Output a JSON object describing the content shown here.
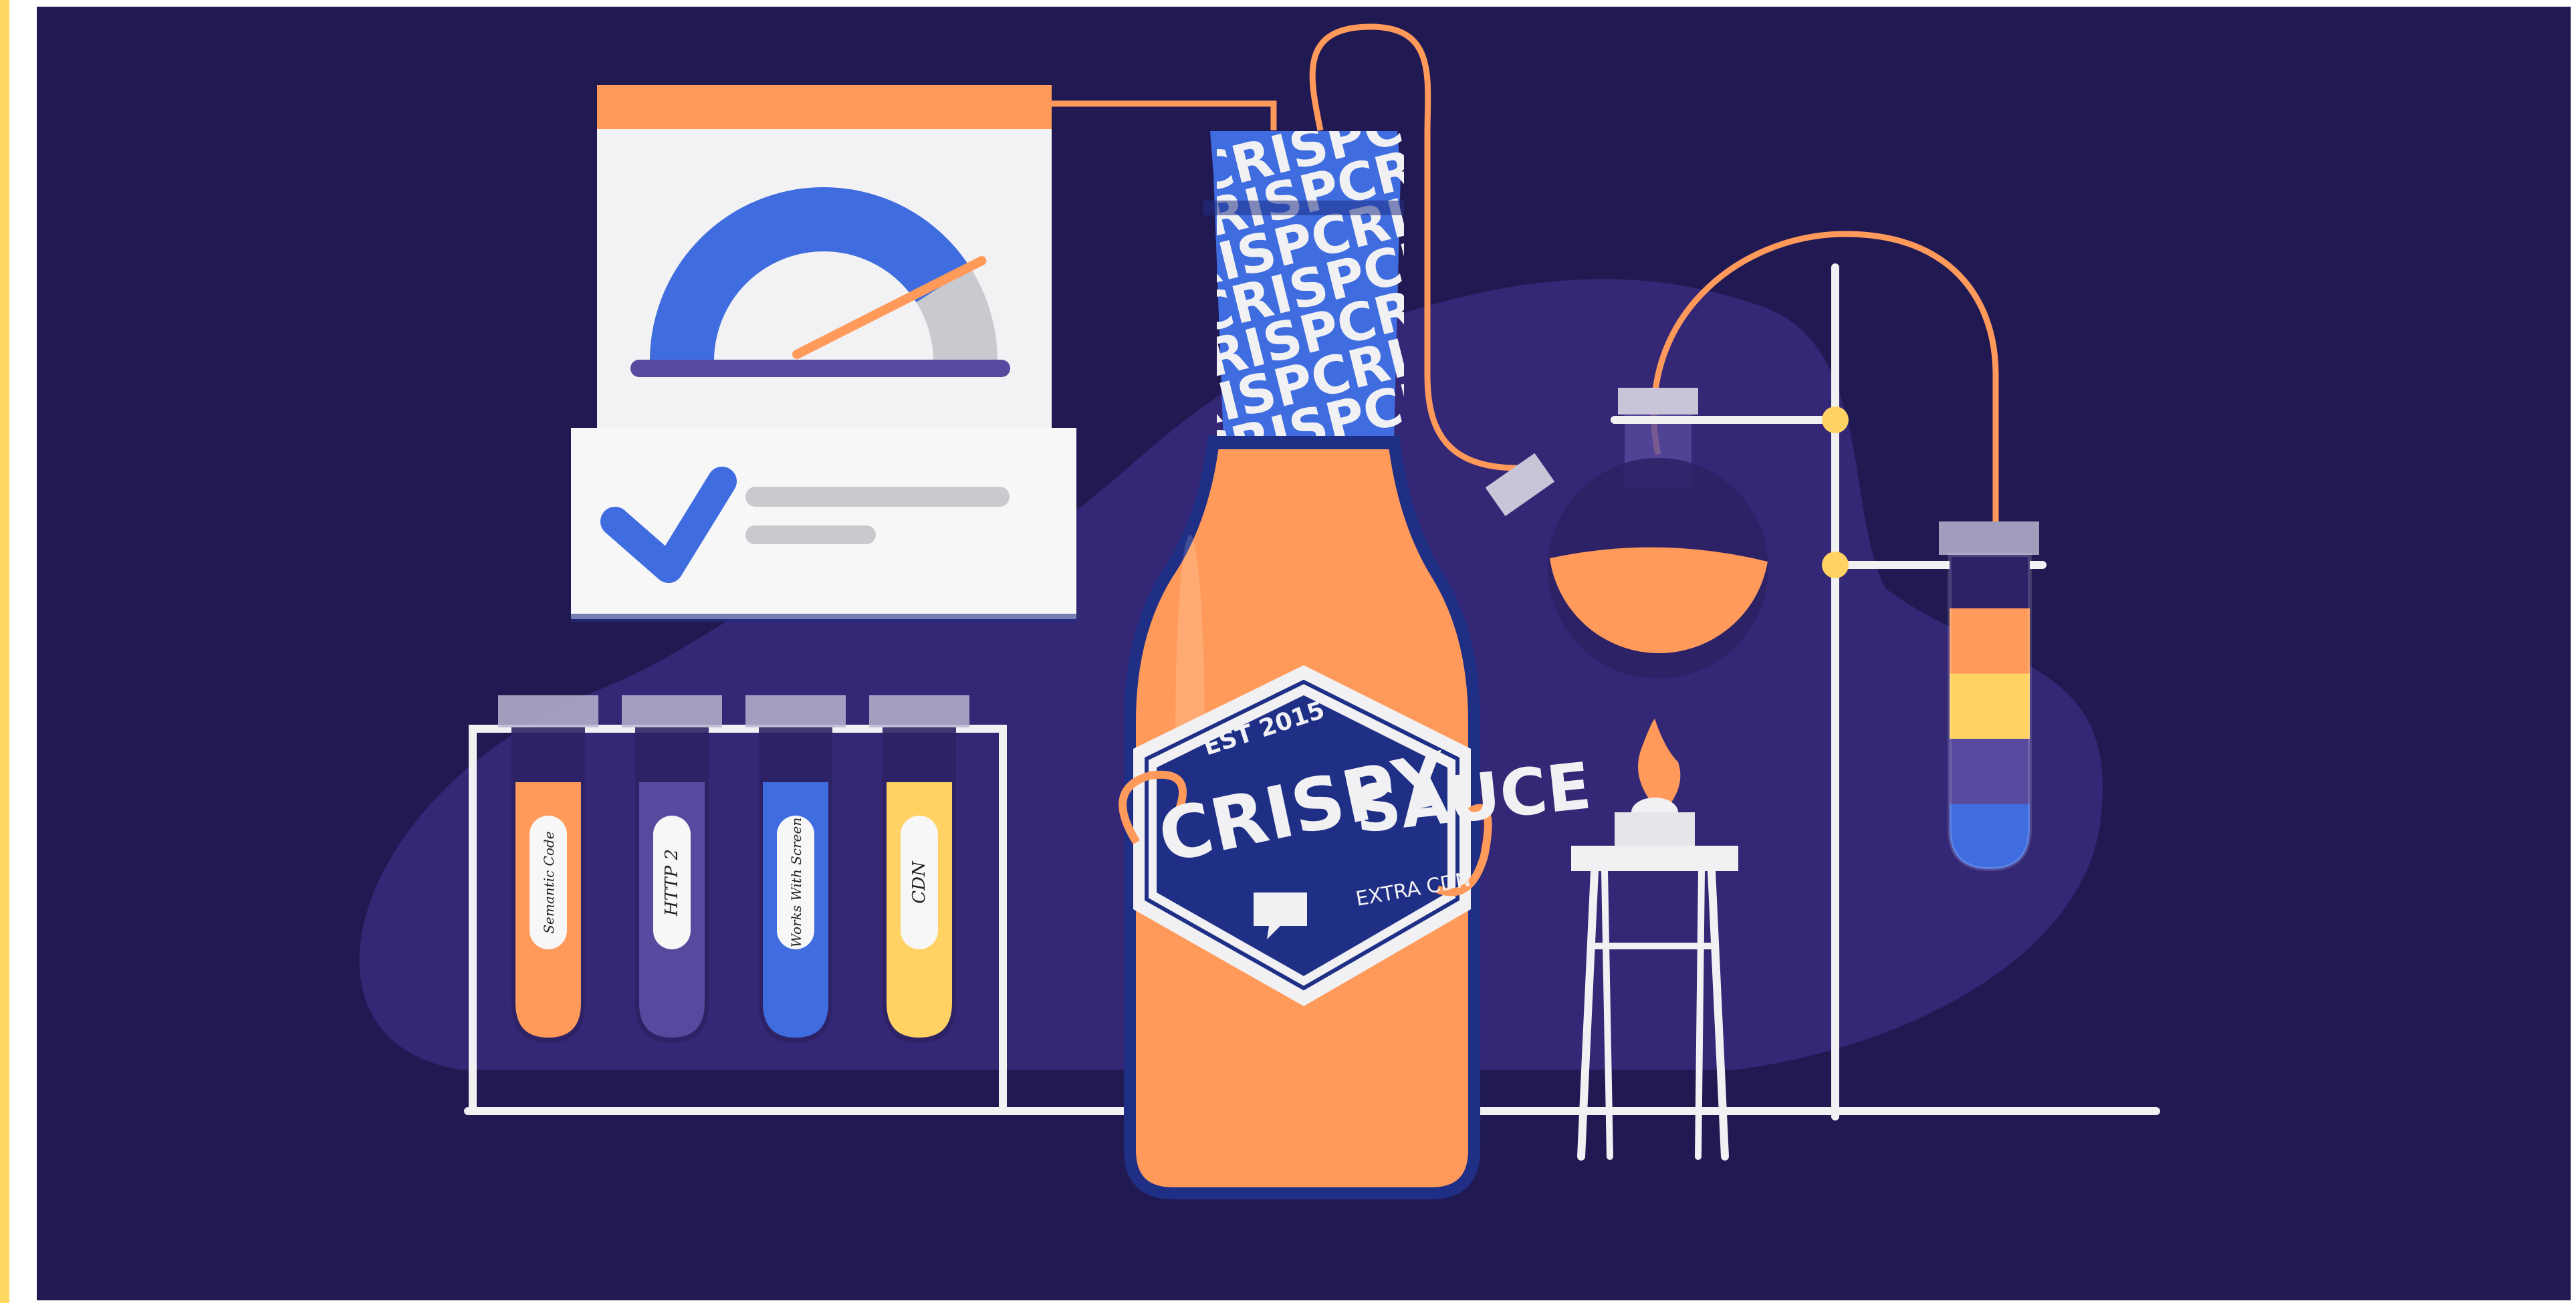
{
  "scene": {
    "colors": {
      "accent_bar": "#FFD861",
      "background": "#211952",
      "blob": "#35297A",
      "orange": "#FF9A5B",
      "blue": "#3F6DE0",
      "purple": "#574A9E",
      "yellow": "#FFD263",
      "white": "#F1F1F3",
      "dark_navy": "#1F2F86"
    },
    "dashboard": {
      "gauge_level": 0.82,
      "check_icon": "checkmark-icon"
    },
    "test_tubes": [
      {
        "label": "Semantic Code",
        "color": "#FF9A5B"
      },
      {
        "label": "HTTP 2",
        "color": "#574A9E"
      },
      {
        "label": "Works With Screen",
        "color": "#3F6DE0"
      },
      {
        "label": "CDN",
        "color": "#FFD263"
      }
    ],
    "bottle": {
      "neck_text": "CRISP",
      "est": "EST 2015",
      "brand_word_1": "CRISPY",
      "brand_word_2": "SAUCE",
      "tagline": "EXTRA CDN",
      "icon": "speech-bubble-icon"
    },
    "layered_tube": {
      "layers": [
        "#FF9A5B",
        "#FFD263",
        "#574A9E",
        "#3F6DE0"
      ]
    }
  }
}
